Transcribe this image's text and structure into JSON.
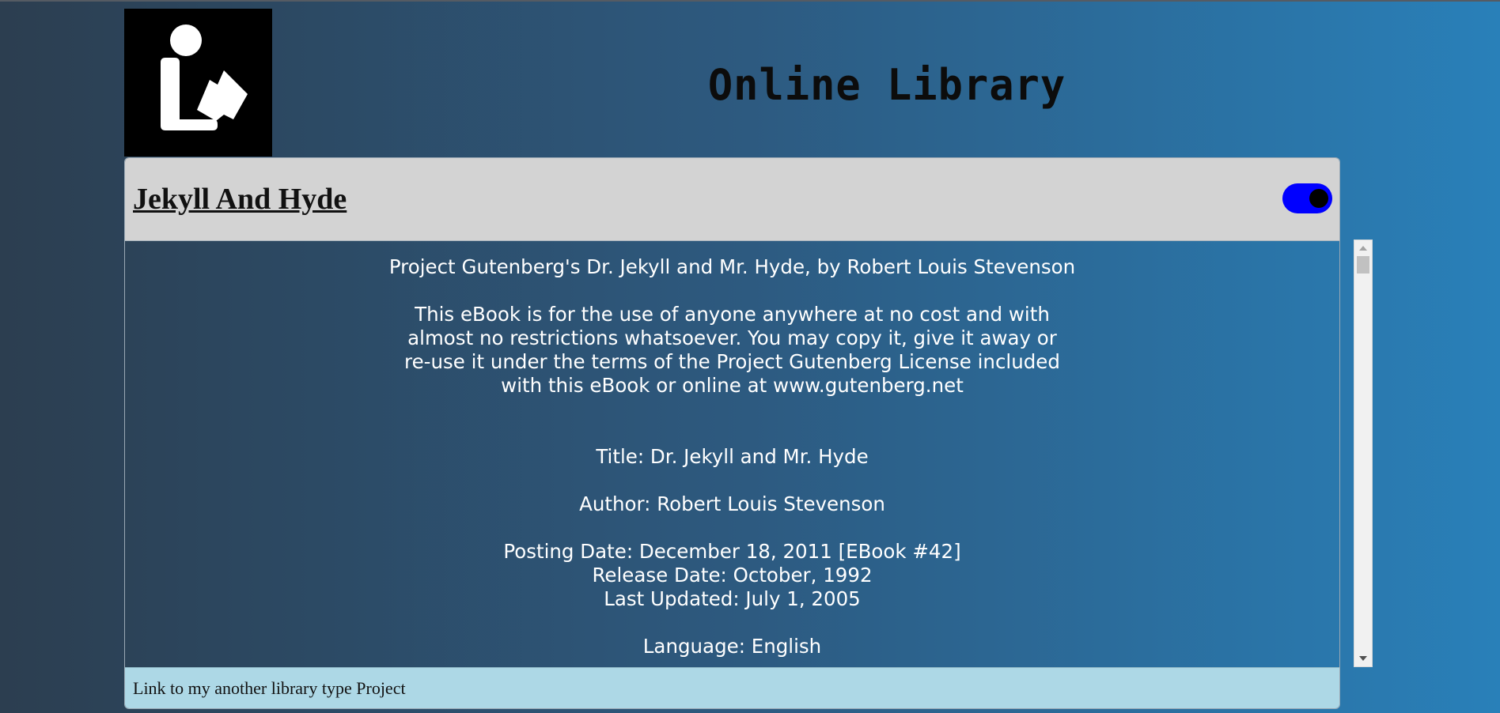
{
  "header": {
    "logo_icon": "library-reader-icon",
    "site_title": "Online Library"
  },
  "book": {
    "title": "Jekyll And Hyde",
    "toggle_state": "on",
    "toggle_color": "#0000ff",
    "text": {
      "line1": "Project Gutenberg's Dr. Jekyll and Mr. Hyde, by Robert Louis Stevenson",
      "license_1": "This eBook is for the use of anyone anywhere at no cost and with",
      "license_2": "almost no restrictions whatsoever. You may copy it, give it away or",
      "license_3": "re-use it under the terms of the Project Gutenberg License included",
      "license_4": "with this eBook or online at www.gutenberg.net",
      "title_line": "Title: Dr. Jekyll and Mr. Hyde",
      "author_line": "Author: Robert Louis Stevenson",
      "posting_date": "Posting Date: December 18, 2011 [EBook #42]",
      "release_date": "Release Date: October, 1992",
      "last_updated": "Last Updated: July 1, 2005",
      "language": "Language: English"
    }
  },
  "footer": {
    "link_text": "Link to my another library type Project"
  },
  "colors": {
    "header_bg": "#d3d3d3",
    "footer_bg": "#add8e6",
    "gradient_start": "#2c3e50",
    "gradient_end": "#2980b9"
  }
}
